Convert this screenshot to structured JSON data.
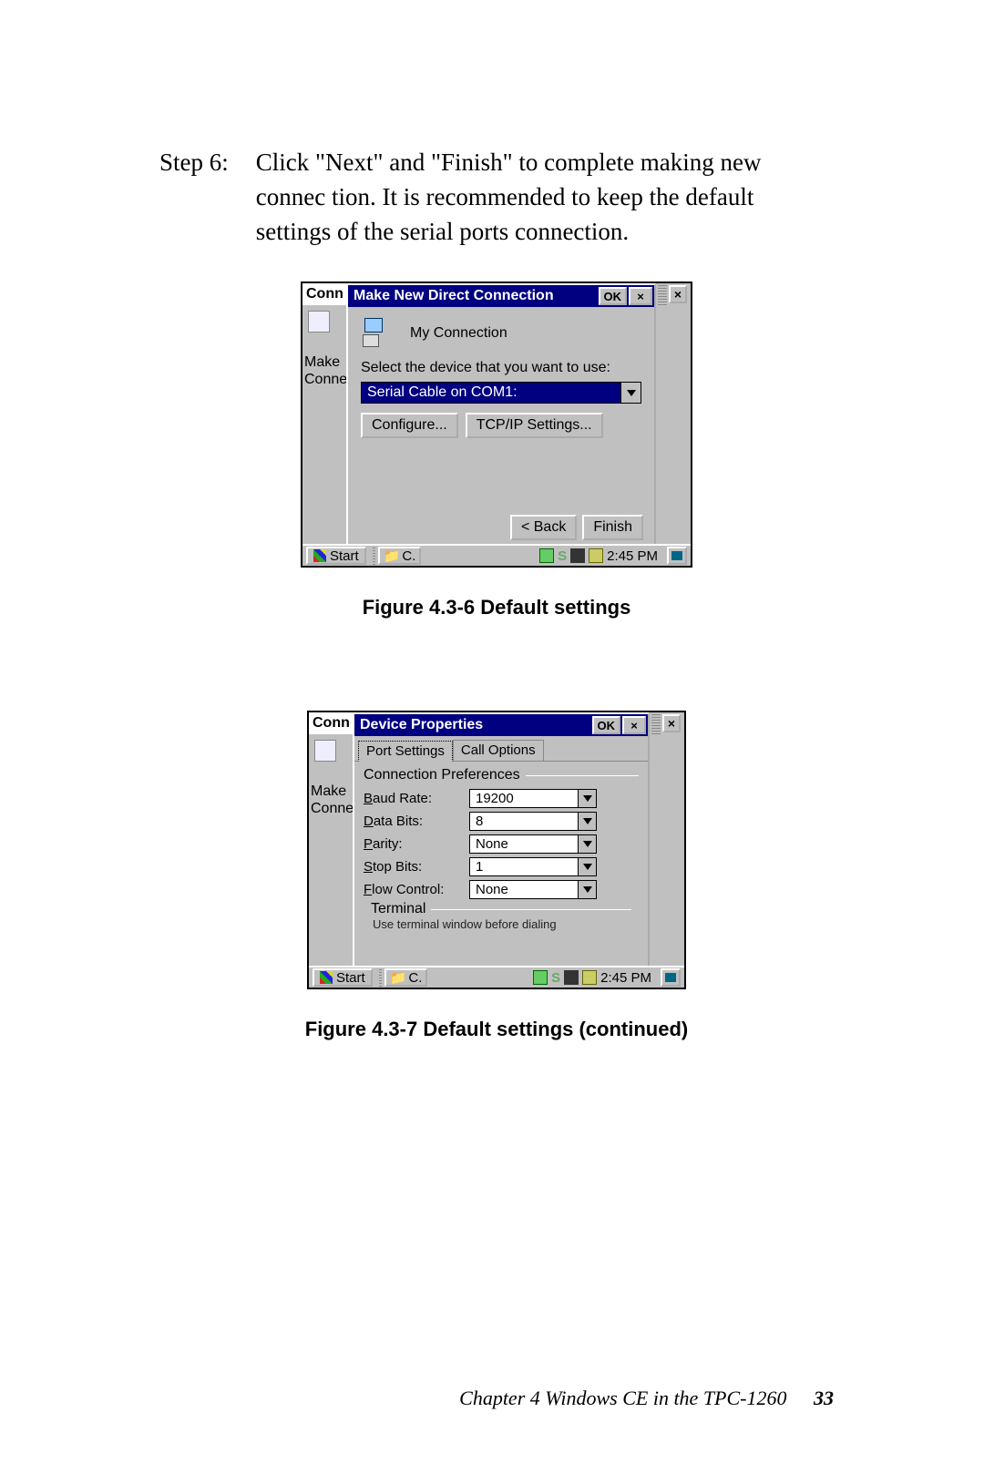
{
  "step": {
    "label": "Step 6:",
    "body": "Click \"Next\" and \"Finish\" to complete making new connec tion. It is recommended to keep the default settings of the serial ports connection."
  },
  "fig1": {
    "caption": "Figure 4.3-6  Default settings",
    "bg": {
      "title": "Conn",
      "make": "Make",
      "conne": "Conne"
    },
    "dialog": {
      "title": "Make New Direct Connection",
      "ok": "OK",
      "close": "×",
      "connection_name": "My Connection",
      "select_prompt": "Select the device that you want to use:",
      "device": "Serial Cable on COM1:",
      "configure": "Configure...",
      "tcpip": "TCP/IP Settings...",
      "back": "< Back",
      "finish": "Finish"
    },
    "taskbar": {
      "start": "Start",
      "item": "C.",
      "time": "2:45 PM",
      "s": "S"
    }
  },
  "fig2": {
    "caption": "Figure 4.3-7  Default settings (continued)",
    "bg": {
      "title": "Conn",
      "make": "Make",
      "conne": "Conne"
    },
    "dialog": {
      "title": "Device Properties",
      "ok": "OK",
      "close": "×",
      "tabs": {
        "port": "Port Settings",
        "call": "Call Options"
      },
      "group": "Connection Preferences",
      "fields": {
        "baud": {
          "label": "Baud Rate:",
          "value": "19200"
        },
        "data": {
          "label": "Data Bits:",
          "value": "8"
        },
        "parity": {
          "label": "Parity:",
          "value": "None"
        },
        "stop": {
          "label": "Stop Bits:",
          "value": "1"
        },
        "flow": {
          "label": "Flow Control:",
          "value": "None"
        }
      },
      "terminal_label": "Terminal",
      "terminal_cut": "Use terminal window before dialing"
    },
    "taskbar": {
      "start": "Start",
      "item": "C.",
      "time": "2:45 PM",
      "s": "S"
    }
  },
  "footer": {
    "chapter": "Chapter 4  Windows CE in the TPC-1260",
    "page": "33"
  }
}
